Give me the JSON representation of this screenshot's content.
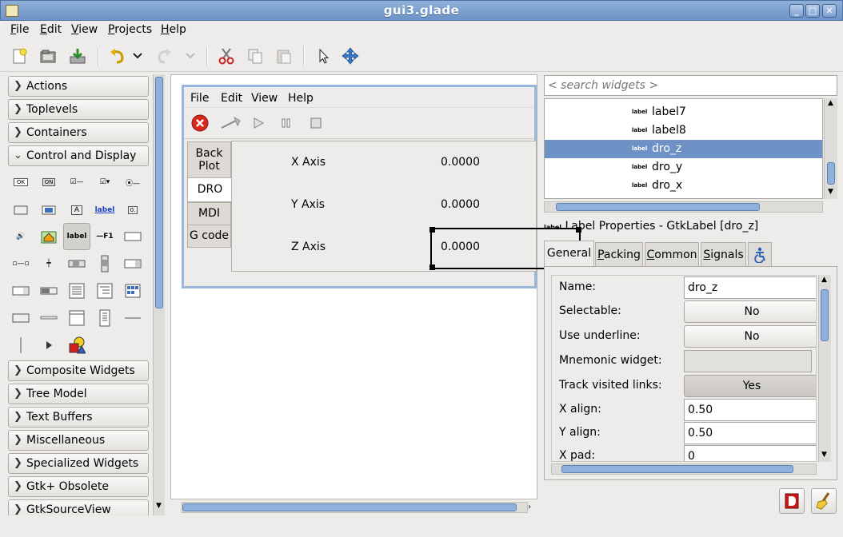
{
  "window": {
    "title": "gui3.glade"
  },
  "menubar": [
    {
      "pre": "",
      "key": "F",
      "post": "ile"
    },
    {
      "pre": "",
      "key": "E",
      "post": "dit"
    },
    {
      "pre": "",
      "key": "V",
      "post": "iew"
    },
    {
      "pre": "",
      "key": "P",
      "post": "rojects"
    },
    {
      "pre": "",
      "key": "H",
      "post": "elp"
    }
  ],
  "toolbar_icons": [
    "new-file-icon",
    "open-icon",
    "save-icon",
    "undo-icon",
    "undo-dropdown-icon",
    "redo-icon",
    "redo-dropdown-icon",
    "cut-icon",
    "copy-icon",
    "paste-icon",
    "pointer-icon",
    "drag-resize-icon"
  ],
  "palette": {
    "groups_top": [
      "Actions",
      "Toplevels",
      "Containers",
      "Control and Display"
    ],
    "icon_labels": {
      "ok": "OK",
      "on": "ON",
      "label_link": "label",
      "label": "label",
      "f1": "F1",
      "zero": "0."
    },
    "groups_bottom": [
      "Composite Widgets",
      "Tree Model",
      "Text Buffers",
      "Miscellaneous",
      "Specialized Widgets",
      "Gtk+ Obsolete",
      "GtkSourceView"
    ]
  },
  "design": {
    "menu": [
      "File",
      "Edit",
      "View",
      "Help"
    ],
    "tabs": [
      "Back\nPlot",
      "DRO",
      "MDI",
      "G code"
    ],
    "active_tab": "DRO",
    "dro": [
      {
        "axis": "X Axis",
        "value": "0.0000"
      },
      {
        "axis": "Y Axis",
        "value": "0.0000"
      },
      {
        "axis": "Z Axis",
        "value": "0.0000"
      }
    ]
  },
  "inspector": {
    "search_placeholder": "< search widgets >",
    "tree": [
      {
        "icon": "label",
        "name": "label7"
      },
      {
        "icon": "label",
        "name": "label8"
      },
      {
        "icon": "label",
        "name": "dro_z",
        "selected": true
      },
      {
        "icon": "label",
        "name": "dro_y"
      },
      {
        "icon": "label",
        "name": "dro_x"
      }
    ]
  },
  "properties": {
    "title_icon": "label",
    "title": "Label Properties - GtkLabel [dro_z]",
    "tabs": [
      "General",
      "Packing",
      "Common",
      "Signals"
    ],
    "active_tab": "General",
    "rows": [
      {
        "label": "Name:",
        "value": "dro_z",
        "kind": "entry"
      },
      {
        "label": "Selectable:",
        "value": "No",
        "kind": "btn"
      },
      {
        "label": "Use underline:",
        "value": "No",
        "kind": "btn"
      },
      {
        "label": "Mnemonic widget:",
        "value": "",
        "kind": "dis"
      },
      {
        "label": "Track visited links:",
        "value": "Yes",
        "kind": "on"
      },
      {
        "label": "X align:",
        "value": "0.50",
        "kind": "entry"
      },
      {
        "label": "Y align:",
        "value": "0.50",
        "kind": "entry"
      },
      {
        "label": "X pad:",
        "value": "0",
        "kind": "entry"
      }
    ]
  }
}
